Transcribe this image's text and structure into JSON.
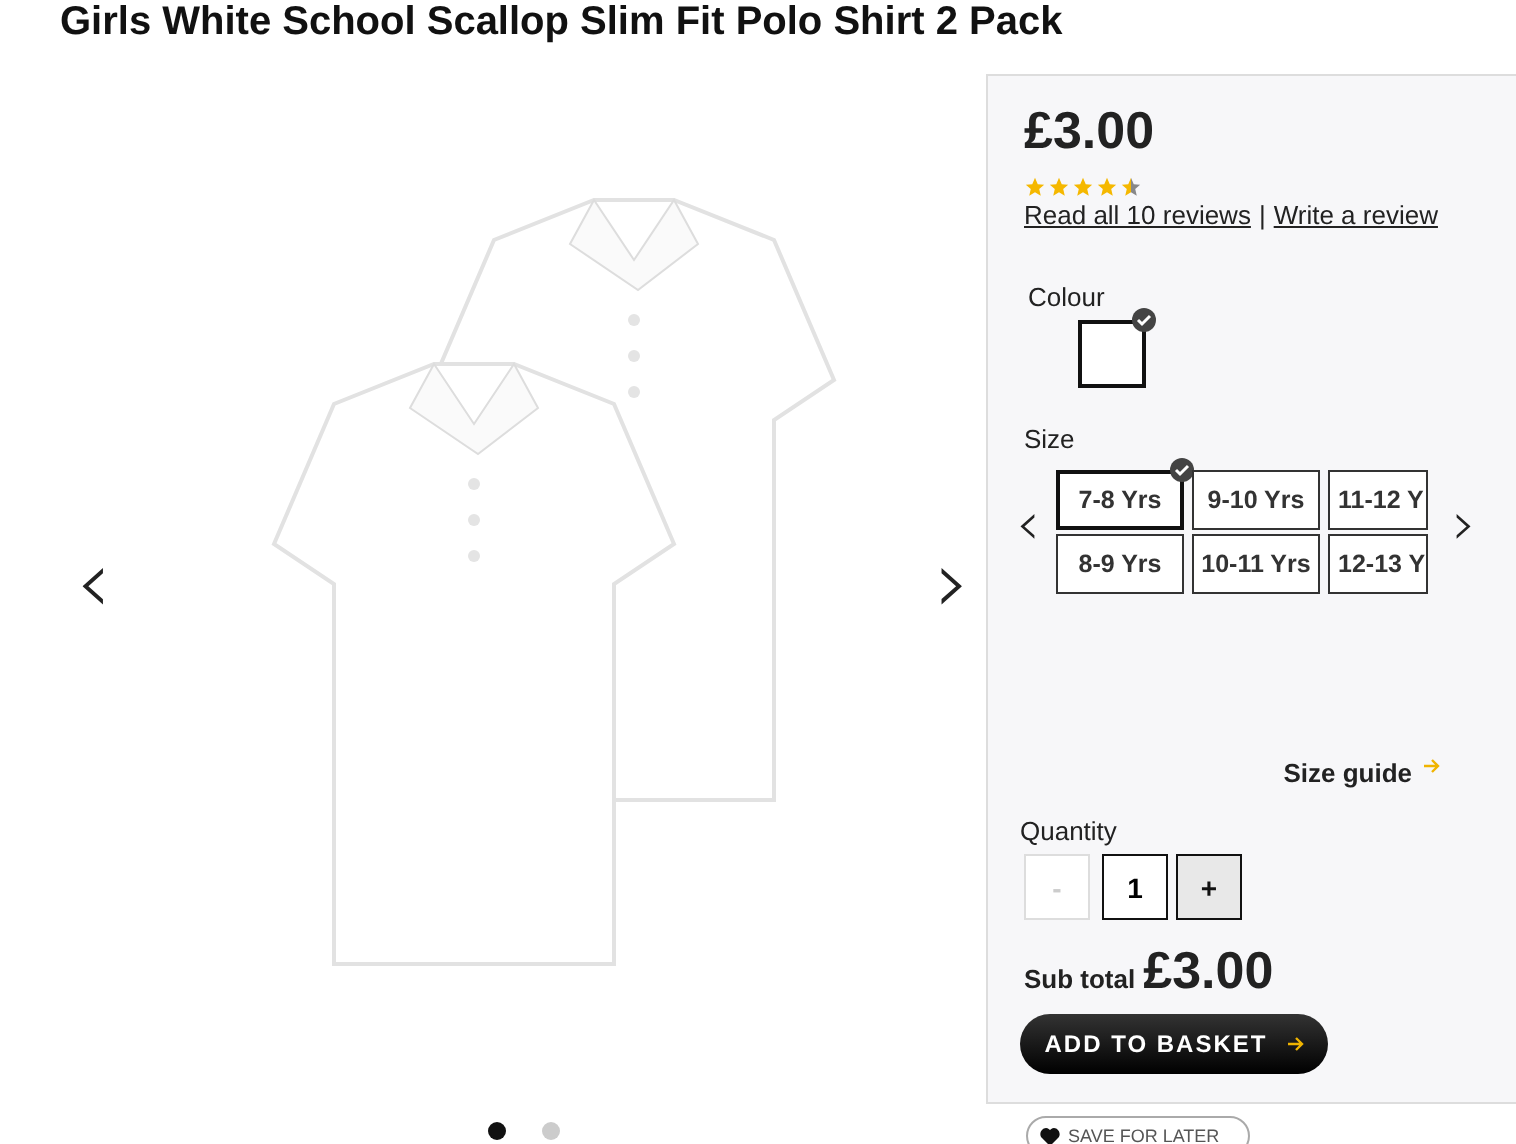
{
  "title": "Girls White School Scallop Slim Fit Polo Shirt 2 Pack",
  "gallery": {
    "prev": "‹",
    "next": "›",
    "dots": [
      {
        "selected": true
      },
      {
        "selected": false
      }
    ]
  },
  "price": "£3.00",
  "stars": 4.5,
  "reviews": {
    "read": "Read all 10 reviews",
    "separator": "|",
    "write": "Write a review"
  },
  "colour": {
    "label": "Colour",
    "swatches": [
      {
        "color": "#ffffff",
        "selected": true
      }
    ]
  },
  "size": {
    "label": "Size",
    "options": [
      {
        "label": "7-8 Yrs",
        "selected": true
      },
      {
        "label": "8-9 Yrs",
        "selected": false
      },
      {
        "label": "9-10 Yrs",
        "selected": false
      },
      {
        "label": "10-11 Yrs",
        "selected": false
      },
      {
        "label": "11-12 Y",
        "selected": false
      },
      {
        "label": "12-13 Y",
        "selected": false
      }
    ]
  },
  "size_guide": "Size guide",
  "quantity": {
    "label": "Quantity",
    "minus": "-",
    "value": "1",
    "plus": "+",
    "minus_disabled": true
  },
  "subtotal": {
    "label": "Sub total",
    "value": "£3.00"
  },
  "add_button": "ADD TO BASKET",
  "save_button": "SAVE FOR LATER"
}
